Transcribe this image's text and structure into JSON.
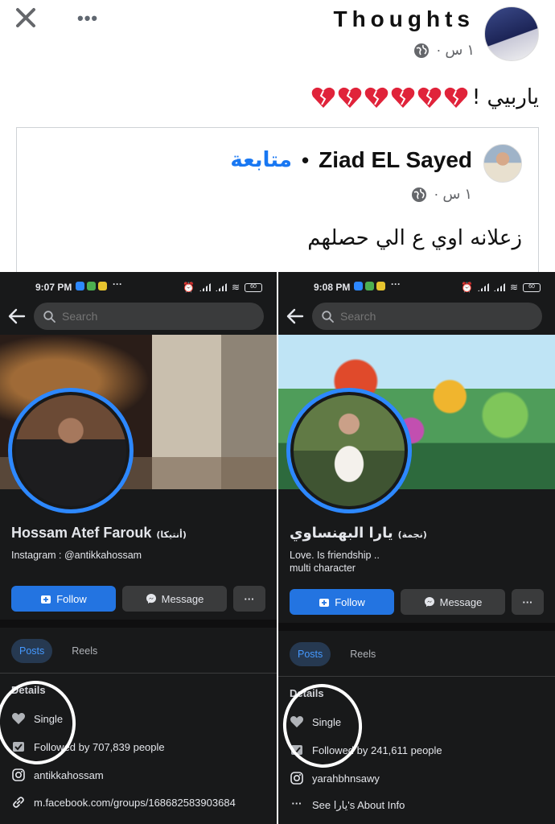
{
  "post": {
    "author": "Thoughts",
    "time": "١ س ·",
    "text": "ياربيي !",
    "heart_count": 6,
    "heart_color": "#e0233a"
  },
  "shared": {
    "name": "Ziad EL Sayed",
    "separator": "•",
    "follow": "متابعة",
    "time": "١ س ·",
    "text": "زعلانه اوي ع الي حصلهم"
  },
  "left_phone": {
    "status_time": "9:07 PM",
    "battery": "60",
    "search_placeholder": "Search",
    "name": "Hossam Atef Farouk",
    "nickname": "(أنتيكا)",
    "bio": "Instagram : @antikkahossam",
    "follow_label": "Follow",
    "message_label": "Message",
    "more_label": "···",
    "tab_posts": "Posts",
    "tab_reels": "Reels",
    "details": "Details",
    "relationship": "Single",
    "followers": "Followed by 707,839 people",
    "instagram": "antikkahossam",
    "link": "m.facebook.com/groups/168682583903684"
  },
  "right_phone": {
    "status_time": "9:08 PM",
    "battery": "60",
    "search_placeholder": "Search",
    "name": "يارا البهنساوي",
    "nickname": "(نجمة)",
    "bio_line1": "Love. Is friendship ..",
    "bio_line2": "multi character",
    "follow_label": "Follow",
    "message_label": "Message",
    "more_label": "···",
    "tab_posts": "Posts",
    "tab_reels": "Reels",
    "details": "Details",
    "relationship": "Single",
    "followers": "Followed by 241,611 people",
    "instagram": "yarahbhnsawy",
    "about": "See يارا's About Info"
  },
  "colors": {
    "fb_blue": "#1877f2",
    "dark_bg": "#18191a",
    "ring_blue": "#2d88ff",
    "annotation": "#ffffff"
  }
}
